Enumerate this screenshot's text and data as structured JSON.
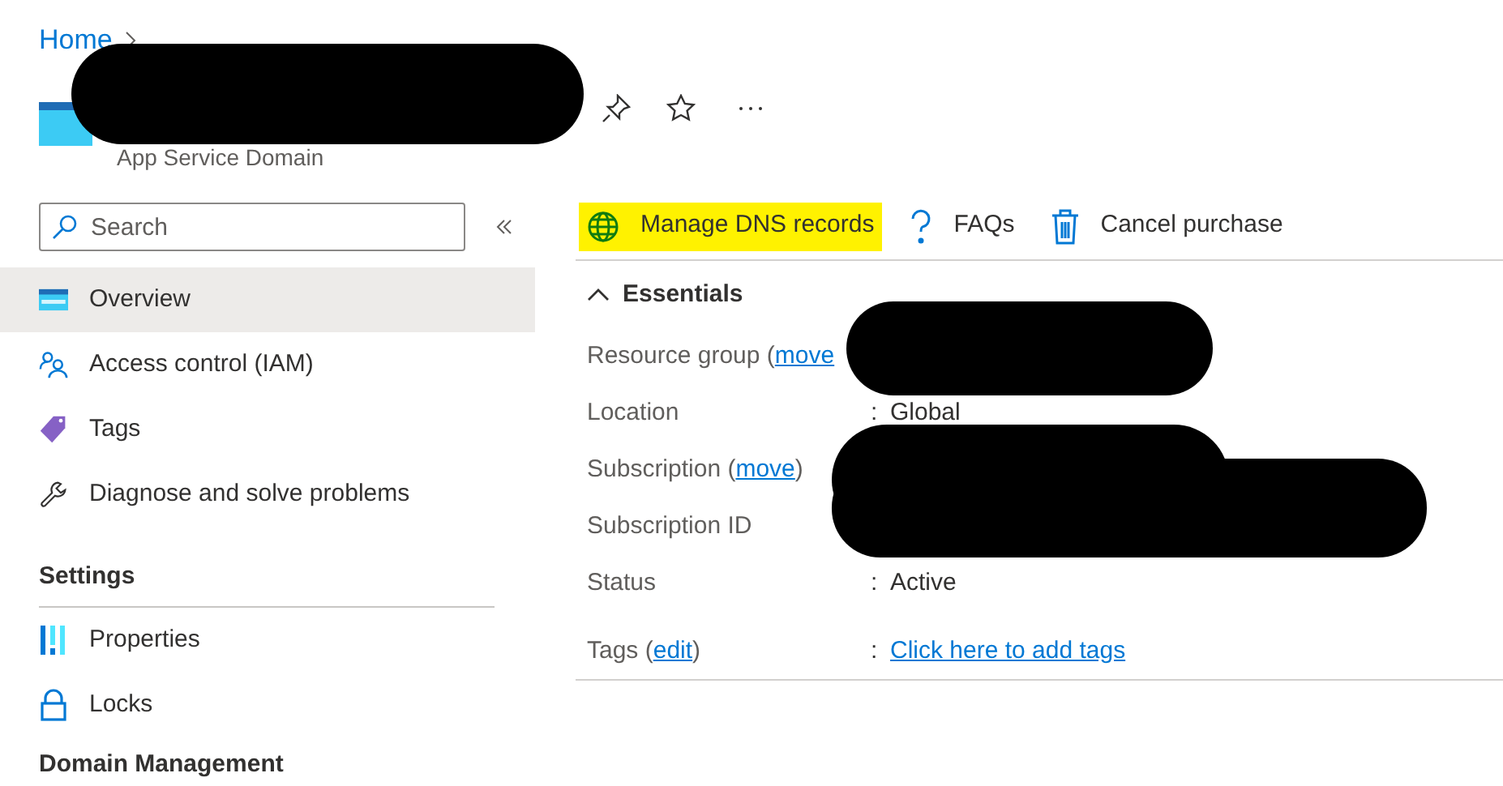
{
  "breadcrumb": [
    {
      "label": "Home"
    }
  ],
  "header": {
    "subtitle": "App Service Domain"
  },
  "sidebar": {
    "search": {
      "placeholder": "Search"
    },
    "sections": [
      {
        "items": [
          {
            "label": "Overview",
            "selected": true
          },
          {
            "label": "Access control (IAM)",
            "selected": false
          },
          {
            "label": "Tags",
            "selected": false
          },
          {
            "label": "Diagnose and solve problems",
            "selected": false
          }
        ]
      },
      {
        "heading": "Settings",
        "items": [
          {
            "label": "Properties",
            "selected": false
          },
          {
            "label": "Locks",
            "selected": false
          }
        ]
      },
      {
        "heading": "Domain Management"
      }
    ]
  },
  "toolbar": [
    {
      "label": "Manage DNS records",
      "highlighted": true
    },
    {
      "label": "FAQs",
      "highlighted": false
    },
    {
      "label": "Cancel purchase",
      "highlighted": false
    }
  ],
  "essentials": {
    "title": "Essentials",
    "expanded": true,
    "rows": [
      {
        "label": "Resource group (",
        "link": "move"
      },
      {
        "label": "Location",
        "separator": ":",
        "value": "Global"
      },
      {
        "label": "Subscription (",
        "link": "move",
        "after": ")"
      },
      {
        "label": "Subscription ID"
      },
      {
        "label": "Status",
        "separator": ":",
        "value": "Active"
      },
      {
        "label": "Tags (",
        "link": "edit",
        "after": ")",
        "separator": ":",
        "value_link": "Click here to add tags"
      }
    ]
  }
}
